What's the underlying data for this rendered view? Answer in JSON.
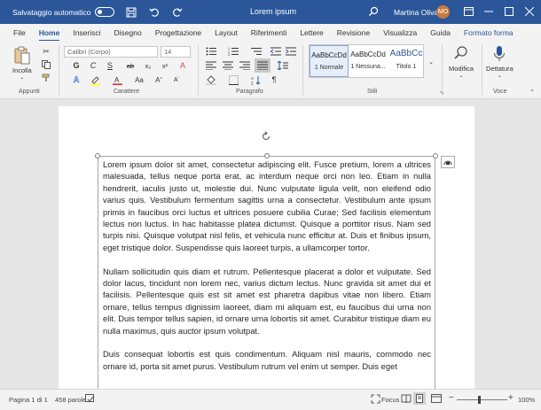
{
  "titlebar": {
    "autosave_label": "Salvataggio automatico",
    "document_title": "Lorem ipsum",
    "user_name": "Martina Oliva",
    "user_initials": "MO"
  },
  "tabs": [
    {
      "label": "File"
    },
    {
      "label": "Home"
    },
    {
      "label": "Inserisci"
    },
    {
      "label": "Disegno"
    },
    {
      "label": "Progettazione"
    },
    {
      "label": "Layout"
    },
    {
      "label": "Riferimenti"
    },
    {
      "label": "Lettere"
    },
    {
      "label": "Revisione"
    },
    {
      "label": "Visualizza"
    },
    {
      "label": "Guida"
    },
    {
      "label": "Formato forma"
    }
  ],
  "ribbon": {
    "paste_label": "Incolla",
    "font_name": "Calibri (Corpo)",
    "font_size": "14",
    "styles": [
      {
        "sample": "AaBbCcDd",
        "name": "1 Normale"
      },
      {
        "sample": "AaBbCcDd",
        "name": "1 Nessuna..."
      },
      {
        "sample": "AaBbCc",
        "name": "Titolo 1"
      }
    ],
    "edit_label": "Modifica",
    "dictate_label": "Dettatura",
    "groups": {
      "clipboard": "Appunti",
      "font": "Carattere",
      "paragraph": "Paragrafo",
      "styles": "Stili",
      "voice": "Voce"
    }
  },
  "document": {
    "paragraphs": [
      "Lorem ipsum dolor sit amet, consectetur adipiscing elit. Fusce pretium, lorem a ultrices malesuada, tellus neque porta erat, ac interdum neque orci non leo. Etiam in nulla hendrerit, iaculis justo ut, molestie dui. Nunc vulputate ligula velit, non eleifend odio varius quis. Vestibulum fermentum sagittis urna a consectetur. Vestibulum ante ipsum primis in faucibus orci luctus et ultrices posuere cubilia Curae; Sed facilisis elementum lectus non luctus. In hac habitasse platea dictumst. Quisque a porttitor risus. Nam sed turpis nisi. Quisque volutpat nisl felis, et vehicula nunc efficitur at. Duis et finibus ipsum, eget tristique dolor. Suspendisse quis laoreet turpis, a ullamcorper tortor.",
      "Nullam sollicitudin quis diam et rutrum. Pellentesque placerat a dolor et vulputate. Sed dolor lacus, tincidunt non lorem nec, varius dictum lectus. Nunc gravida sit amet dui et facilisis. Pellentesque quis est sit amet est pharetra dapibus vitae non libero. Etiam ornare, tellus tempus dignissim laoreet, diam mi aliquam est, eu faucibus dui urna non elit. Duis tempor tellus sapien, id ornare urna lobortis sit amet. Curabitur tristique diam eu nulla maximus, quis auctor ipsum volutpat.",
      "Duis consequat lobortis est quis condimentum. Aliquam nisl mauris, commodo nec ornare id, porta sit amet purus. Vestibulum rutrum vel enim ut semper. Duis eget"
    ]
  },
  "statusbar": {
    "page": "Pagina 1 di 1",
    "words": "458 parole",
    "focus": "Focus",
    "zoom": "100%"
  },
  "colors": {
    "accent": "#2b579a"
  }
}
